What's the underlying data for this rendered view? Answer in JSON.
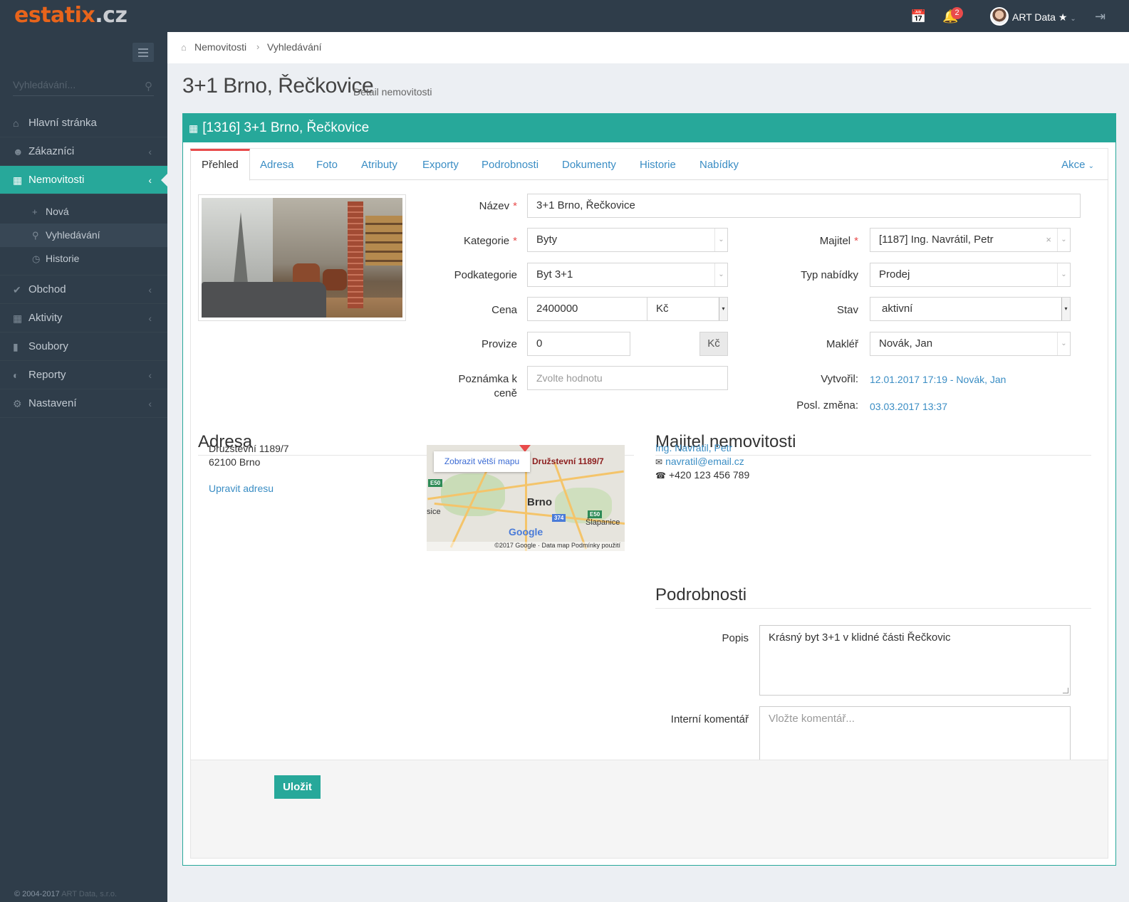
{
  "brand": {
    "part1": "estatix",
    "part2": ".cz"
  },
  "topbar": {
    "notifications_count": "2",
    "user_name": "ART Data"
  },
  "sidebar": {
    "search_placeholder": "Vyhledávání...",
    "items": [
      {
        "label": "Hlavní stránka",
        "icon": "home-icon"
      },
      {
        "label": "Zákazníci",
        "icon": "users-icon"
      },
      {
        "label": "Nemovitosti",
        "icon": "building-icon"
      },
      {
        "label": "Obchod",
        "icon": "check-circle-icon"
      },
      {
        "label": "Aktivity",
        "icon": "calendar-icon"
      },
      {
        "label": "Soubory",
        "icon": "file-icon"
      },
      {
        "label": "Reporty",
        "icon": "chart-icon"
      },
      {
        "label": "Nastavení",
        "icon": "gear-icon"
      }
    ],
    "subitems": [
      {
        "label": "Nová",
        "icon": "plus-icon"
      },
      {
        "label": "Vyhledávání",
        "icon": "search-icon"
      },
      {
        "label": "Historie",
        "icon": "clock-icon"
      }
    ],
    "copyright": "© 2004-2017",
    "copyright_brand": "ART Data, s.r.o."
  },
  "breadcrumb": {
    "items": [
      "Nemovitosti",
      "Vyhledávání"
    ]
  },
  "page": {
    "title": "3+1 Brno, Řečkovice",
    "subtitle": "Detail nemovitosti"
  },
  "panel": {
    "title": "[1316] 3+1 Brno, Řečkovice"
  },
  "tabs": [
    "Přehled",
    "Adresa",
    "Foto",
    "Atributy",
    "Exporty",
    "Podrobnosti",
    "Dokumenty",
    "Historie",
    "Nabídky"
  ],
  "actions_label": "Akce",
  "form": {
    "nazev_label": "Název",
    "nazev_value": "3+1 Brno, Řečkovice",
    "kategorie_label": "Kategorie",
    "kategorie_value": "Byty",
    "podkategorie_label": "Podkategorie",
    "podkategorie_value": "Byt 3+1",
    "cena_label": "Cena",
    "cena_value": "2400000",
    "mena_value": "Kč",
    "provize_label": "Provize",
    "provize_value": "0",
    "provize_unit": "Kč",
    "poznamka_label_1": "Poznámka k",
    "poznamka_label_2": "ceně",
    "poznamka_placeholder": "Zvolte hodnotu",
    "majitel_label": "Majitel",
    "majitel_value": "[1187] Ing. Navrátil, Petr",
    "typ_label": "Typ nabídky",
    "typ_value": "Prodej",
    "stav_label": "Stav",
    "stav_value": "aktivní",
    "makler_label": "Makléř",
    "makler_value": "Novák, Jan",
    "vytvoril_label": "Vytvořil:",
    "vytvoril_value": "12.01.2017 17:19 - Novák, Jan",
    "zmena_label": "Posl. změna:",
    "zmena_value": "03.03.2017 13:37"
  },
  "address": {
    "title": "Adresa",
    "street": "Družstevní 1189/7",
    "city": "62100 Brno",
    "edit_link": "Upravit adresu",
    "map": {
      "button": "Zobrazit větší mapu",
      "pin_label": "Družstevní 1189/7",
      "city": "Brno",
      "place_left": "sice",
      "place_right": "Šlapanice",
      "road_e50_1": "E50",
      "road_e50_2": "E50",
      "road_374": "374",
      "logo": "Google",
      "footer": "©2017 Google · Data map   Podmínky použití"
    }
  },
  "owner": {
    "title": "Majitel nemovitosti",
    "name": "Ing. Navrátil, Petr",
    "email": "navratil@email.cz",
    "phone": "+420 123 456 789"
  },
  "details": {
    "title": "Podrobnosti",
    "popis_label": "Popis",
    "popis_value": "Krásný byt 3+1 v klidné části Řečkovic",
    "komentar_label": "Interní komentář",
    "komentar_placeholder": "Vložte komentář..."
  },
  "save_label": "Uložit"
}
